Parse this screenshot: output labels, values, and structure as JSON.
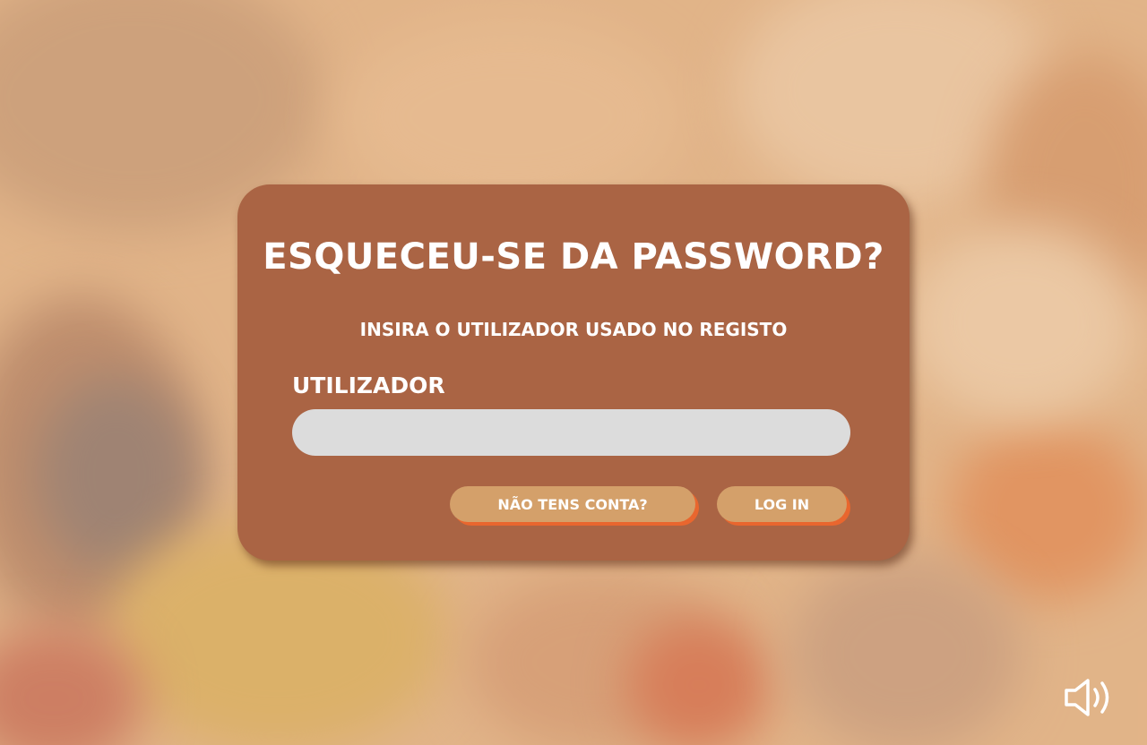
{
  "card": {
    "title": "ESQUECEU-SE DA PASSWORD?",
    "subtitle": "INSIRA O UTILIZADOR USADO NO REGISTO",
    "username_label": "UTILIZADOR",
    "username_value": ""
  },
  "buttons": {
    "signup_label": "NÃO TENS CONTA?",
    "login_label": "LOG IN"
  },
  "icons": {
    "sound": "speaker-volume-icon"
  },
  "colors": {
    "card_background": "#aa6444",
    "input_background": "#dcdcdc",
    "button_background": "#d4a06a",
    "button_shadow": "#e9662e",
    "text": "#ffffff"
  }
}
